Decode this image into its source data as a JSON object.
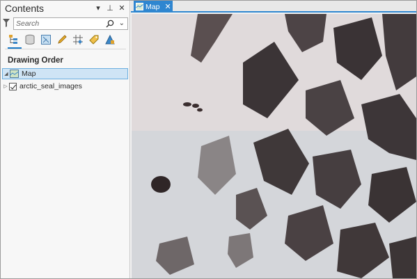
{
  "contents_pane": {
    "title": "Contents",
    "controls": {
      "menu": "▾",
      "pin": "⊥",
      "close": "✕"
    },
    "search": {
      "placeholder": "Search"
    },
    "toolbar": [
      "list-by-drawing-order-icon",
      "list-by-source-icon",
      "list-by-selection-icon",
      "list-by-editing-icon",
      "list-by-snapping-icon",
      "list-by-labeling-icon",
      "list-by-charts-icon"
    ],
    "section_title": "Drawing Order",
    "tree": {
      "map_label": "Map",
      "layer_label": "arctic_seal_images",
      "layer_checked": true
    }
  },
  "map_view": {
    "tab_label": "Map",
    "tab_close": "✕",
    "content": "aerial imagery of snow and dark rock terrain"
  },
  "colors": {
    "accent": "#2f86d0",
    "selection_bg": "#cfe4f5",
    "selection_border": "#6aaedf"
  }
}
